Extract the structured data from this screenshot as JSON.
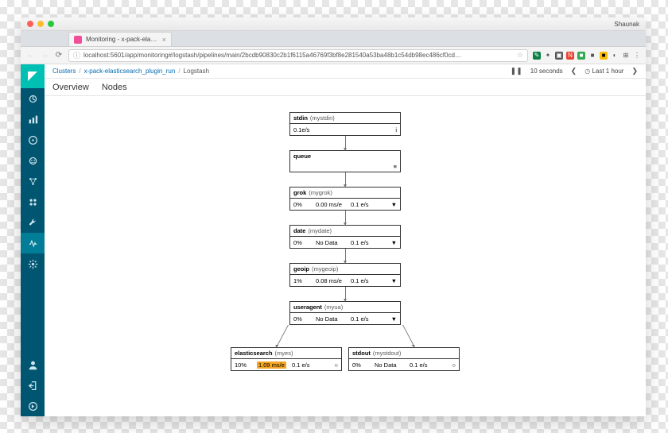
{
  "browser": {
    "profile": "Shaunak",
    "tab": {
      "title": "Monitoring - x-pack-elasticse"
    },
    "url": "localhost:5601/app/monitoring#/logstash/pipelines/main/2bcdb90830c2b1f6115a46769f3bf8e281540a53ba48b1c54db98ec486cf0cd…"
  },
  "colors": {
    "sidebar": "#005571",
    "accent": "#00bfb3",
    "link": "#006bb4",
    "hot": "#f5a623"
  },
  "breadcrumbs": {
    "a": "Clusters",
    "b": "x-pack-elasticsearch_plugin_run",
    "c": "Logstash"
  },
  "timepicker": {
    "interval": "10 seconds",
    "range": "Last 1 hour"
  },
  "subnav": {
    "overview": "Overview",
    "nodes": "Nodes"
  },
  "pipeline": {
    "stdin": {
      "name": "stdin",
      "id": "(mystdin)",
      "evs": "0.1e/s",
      "icon": "i"
    },
    "queue": {
      "name": "queue",
      "icon": "≡"
    },
    "grok": {
      "name": "grok",
      "id": "(mygrok)",
      "pct": "0%",
      "ms": "0.00 ms/e",
      "evs": "0.1 e/s"
    },
    "date": {
      "name": "date",
      "id": "(mydate)",
      "pct": "0%",
      "ms": "No Data",
      "evs": "0.1 e/s"
    },
    "geoip": {
      "name": "geoip",
      "id": "(mygeoip)",
      "pct": "1%",
      "ms": "0.08 ms/e",
      "evs": "0.1 e/s"
    },
    "ua": {
      "name": "useragent",
      "id": "(myua)",
      "pct": "0%",
      "ms": "No Data",
      "evs": "0.1 e/s"
    },
    "es": {
      "name": "elasticsearch",
      "id": "(myes)",
      "pct": "10%",
      "ms": "1.09 ms/e",
      "evs": "0.1 e/s"
    },
    "stdout": {
      "name": "stdout",
      "id": "(mystdout)",
      "pct": "0%",
      "ms": "No Data",
      "evs": "0.1 e/s"
    }
  }
}
